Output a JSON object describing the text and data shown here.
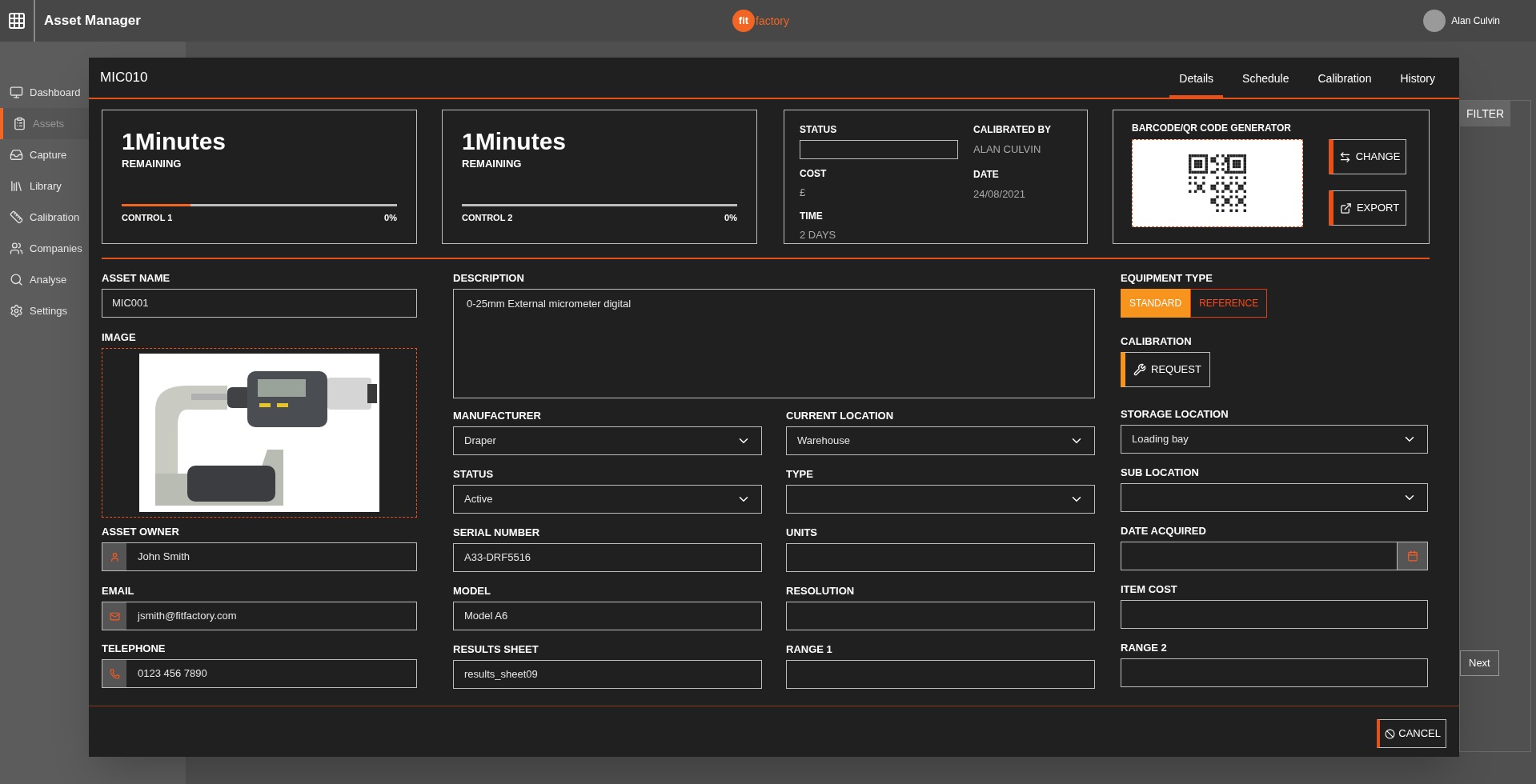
{
  "topbar": {
    "title": "Asset Manager",
    "logo": {
      "part_1": "fit",
      "part_2": "factory"
    },
    "user": "Alan Culvin"
  },
  "sidebar": {
    "items": [
      {
        "label": "Dashboard",
        "selected": false
      },
      {
        "label": "Assets",
        "selected": true
      },
      {
        "label": "Capture",
        "selected": false
      },
      {
        "label": "Library",
        "selected": false
      },
      {
        "label": "Calibration",
        "selected": false
      },
      {
        "label": "Companies",
        "selected": false
      },
      {
        "label": "Analyse",
        "selected": false
      },
      {
        "label": "Settings",
        "selected": false
      }
    ]
  },
  "background": {
    "filter_button": "FILTER",
    "next_button": "Next"
  },
  "modal": {
    "title": "MIC010",
    "tabs": [
      {
        "label": "Details",
        "selected": true
      },
      {
        "label": "Schedule",
        "selected": false
      },
      {
        "label": "Calibration",
        "selected": false
      },
      {
        "label": "History",
        "selected": false
      }
    ],
    "timers": [
      {
        "value": "1Minutes",
        "caption": "REMAINING",
        "control": "CONTROL 1",
        "percent": "0%",
        "level": 0.25
      },
      {
        "value": "1Minutes",
        "caption": "REMAINING",
        "control": "CONTROL 2",
        "percent": "0%",
        "level": 0
      }
    ],
    "summary": {
      "status_label": "STATUS",
      "cost": {
        "label": "COST",
        "value": "£"
      },
      "time": {
        "label": "TIME",
        "value": "2 DAYS"
      },
      "calibrated_by": {
        "label": "CALIBRATED BY",
        "value": "ALAN CULVIN"
      },
      "date": {
        "label": "DATE",
        "value": "24/08/2021"
      }
    },
    "qr": {
      "title": "BARCODE/QR CODE GENERATOR",
      "buttons": [
        "CHANGE",
        "EXPORT"
      ]
    },
    "left": {
      "asset_name": {
        "label": "ASSET NAME",
        "value": "MIC001"
      },
      "image_label": "IMAGE",
      "contacts": [
        {
          "label": "ASSET OWNER",
          "value": "John Smith"
        },
        {
          "label": "EMAIL",
          "value": "jsmith@fitfactory.com"
        },
        {
          "label": "TELEPHONE",
          "value": "0123 456 7890"
        }
      ]
    },
    "description": {
      "label": "DESCRIPTION",
      "value": "0-25mm External micrometer digital"
    },
    "middle_fields": [
      {
        "kind": "select",
        "label": "MANUFACTURER",
        "value": "Draper"
      },
      {
        "kind": "select",
        "label": "CURRENT LOCATION",
        "value": "Warehouse"
      },
      {
        "kind": "select",
        "label": "STATUS",
        "value": "Active"
      },
      {
        "kind": "select",
        "label": "TYPE"
      },
      {
        "kind": "text",
        "label": "SERIAL NUMBER",
        "value": "A33-DRF5516"
      },
      {
        "kind": "text",
        "label": "UNITS"
      },
      {
        "kind": "text",
        "label": "MODEL",
        "value": "Model A6"
      },
      {
        "kind": "text",
        "label": "RESOLUTION"
      },
      {
        "kind": "text",
        "label": "RESULTS SHEET",
        "value": "results_sheet09"
      },
      {
        "kind": "text",
        "label": "RANGE 1"
      }
    ],
    "equipment_type": {
      "label": "EQUIPMENT TYPE",
      "options": [
        {
          "label": "STANDARD",
          "selected": true
        },
        {
          "label": "REFERENCE",
          "selected": false
        }
      ]
    },
    "calibration": {
      "label": "CALIBRATION",
      "button": "REQUEST"
    },
    "right_fields": [
      {
        "kind": "select",
        "label": "STORAGE LOCATION",
        "value": "Loading bay"
      },
      {
        "kind": "select",
        "label": "SUB LOCATION"
      },
      {
        "kind": "date",
        "label": "DATE ACQUIRED"
      },
      {
        "kind": "text",
        "label": "ITEM COST"
      },
      {
        "kind": "text",
        "label": "RANGE 2"
      }
    ],
    "cancel_button": "CANCEL"
  }
}
